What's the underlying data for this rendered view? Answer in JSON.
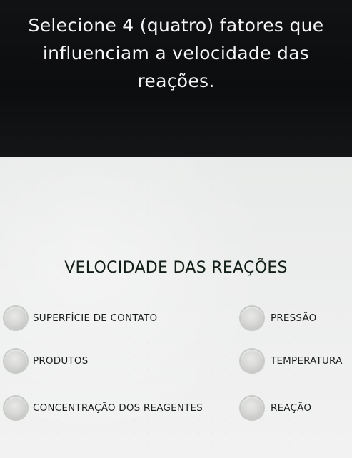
{
  "header": {
    "question": "Selecione 4 (quatro) fatores que influenciam a velocidade das reações."
  },
  "content": {
    "title": "VELOCIDADE DAS REAÇÕES",
    "options": [
      {
        "label": "SUPERFÍCIE DE CONTATO"
      },
      {
        "label": "PRESSÃO"
      },
      {
        "label": "PRODUTOS"
      },
      {
        "label": "TEMPERATURA"
      },
      {
        "label": "CONCENTRAÇÃO DOS REAGENTES"
      },
      {
        "label": "REAÇÃO"
      }
    ]
  }
}
